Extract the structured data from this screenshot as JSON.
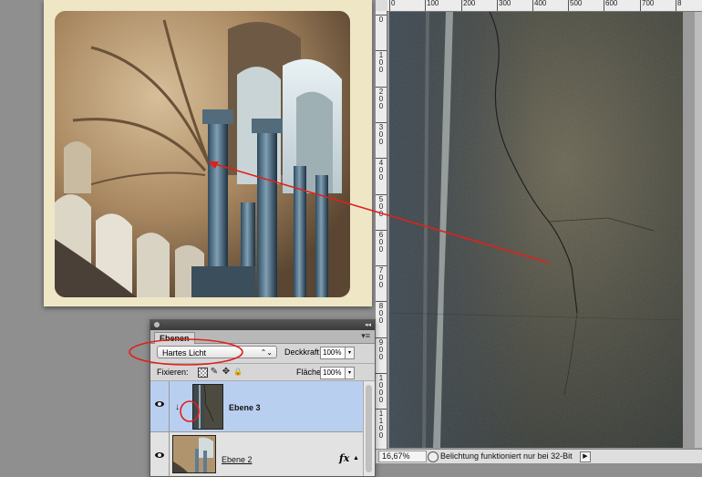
{
  "document": {
    "ruler_top_labels": [
      "0",
      "100",
      "200",
      "300",
      "400",
      "500",
      "600",
      "700",
      "8"
    ],
    "ruler_left_labels": [
      "0",
      "1\n0\n0",
      "2\n0\n0",
      "3\n0\n0",
      "4\n0\n0",
      "5\n0\n0",
      "6\n0\n0",
      "7\n0\n0",
      "8\n0\n0",
      "9\n0\n0",
      "1\n0\n0\n0",
      "1\n1\n0\n0"
    ],
    "zoom": "16,67%",
    "status_message": "Belichtung funktioniert nur bei 32-Bit",
    "status_arrow": "▶"
  },
  "layers_panel": {
    "collapse_glyph": "◂◂",
    "tab_label": "Ebenen",
    "menu_glyph": "▾≡",
    "blend_mode": "Hartes Licht",
    "select_arrows": "⌃⌄",
    "opacity_label": "Deckkraft:",
    "opacity_value": "100%",
    "lock_label": "Fixieren:",
    "lock_icons": {
      "brush": "✎",
      "move": "✥",
      "lock": "🔒"
    },
    "fill_label": "Fläche:",
    "fill_value": "100%",
    "stepper_glyph": "▾",
    "layers": [
      {
        "name": "Ebene 3",
        "selected": true,
        "clipped": true,
        "clip_glyph": "↓"
      },
      {
        "name": "Ebene 2",
        "selected": false,
        "fx": "fx",
        "fx_toggle": "▲"
      }
    ]
  },
  "colors": {
    "workspace": "#8f8f8f",
    "selection": "#b9cff0",
    "annotation_red": "#e0201b"
  }
}
